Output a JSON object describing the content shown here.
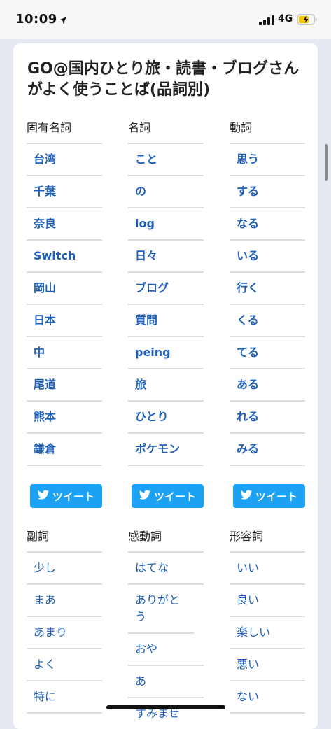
{
  "status_bar": {
    "time": "10:09",
    "network": "4G",
    "accent_color": "#f7c600"
  },
  "page": {
    "title": "GO@国内ひとり旅・読書・ブログさんがよく使うことば(品詞別)"
  },
  "tweet_label": "ツイート",
  "sections": [
    {
      "columns": [
        {
          "title": "固有名詞",
          "words": [
            "台湾",
            "千葉",
            "奈良",
            "Switch",
            "岡山",
            "日本",
            "中",
            "尾道",
            "熊本",
            "鎌倉"
          ]
        },
        {
          "title": "名詞",
          "words": [
            "こと",
            "の",
            "log",
            "日々",
            "ブログ",
            "質問",
            "peing",
            "旅",
            "ひとり",
            "ポケモン"
          ]
        },
        {
          "title": "動詞",
          "words": [
            "思う",
            "する",
            "なる",
            "いる",
            "行く",
            "くる",
            "てる",
            "ある",
            "れる",
            "みる"
          ]
        }
      ]
    },
    {
      "columns": [
        {
          "title": "副詞",
          "words": [
            "少し",
            "まあ",
            "あまり",
            "よく",
            "特に"
          ]
        },
        {
          "title": "感動詞",
          "words": [
            "はてな",
            "ありがとう",
            "おや",
            "あ",
            "すみませ"
          ]
        },
        {
          "title": "形容詞",
          "words": [
            "いい",
            "良い",
            "楽しい",
            "悪い",
            "ない"
          ]
        }
      ]
    }
  ],
  "colors": {
    "link": "#1f5fb8",
    "tweet_button": "#1da1f2",
    "background": "#e6e9f1"
  }
}
